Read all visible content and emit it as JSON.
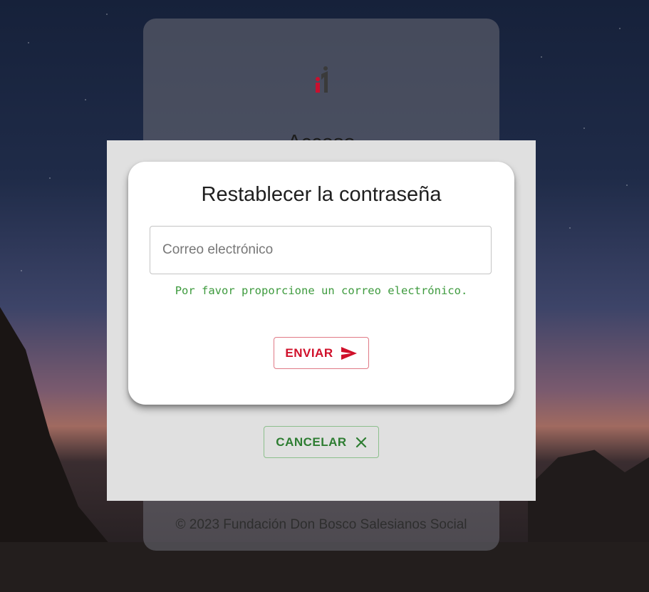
{
  "login": {
    "title": "Acceso",
    "footer": "© 2023 Fundación Don Bosco Salesianos Social",
    "logo_icon": "brand-logo-icon"
  },
  "dialog": {
    "title": "Restablecer la contraseña",
    "email_placeholder": "Correo electrónico",
    "email_value": "",
    "helper_text": "Por favor proporcione un correo electrónico.",
    "send_label": "ENVIAR",
    "send_icon": "send-icon",
    "cancel_label": "CANCELAR",
    "cancel_icon": "close-icon"
  },
  "colors": {
    "send": "#d0102a",
    "cancel": "#2e7d32",
    "helper": "#3d9a3d",
    "overlay": "#e0e0e0"
  }
}
